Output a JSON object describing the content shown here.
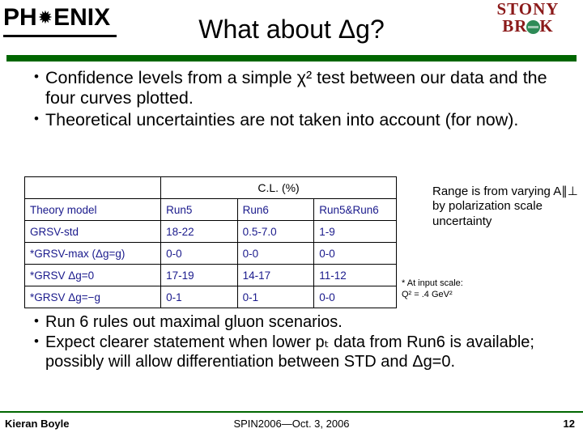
{
  "header": {
    "logo_left": {
      "part1": "PH",
      "star": "✹",
      "part2": "ENIX"
    },
    "title": "What about Δg?",
    "logo_right": {
      "line1": "STONY",
      "line2_a": "BR",
      "line2_b": "K"
    }
  },
  "bullets_top": [
    "Confidence levels from a simple χ² test between our data and the four curves plotted.",
    "Theoretical uncertainties are not taken into account (for now)."
  ],
  "table": {
    "super_header": "C.L. (%)",
    "columns": [
      "Theory model",
      "Run5",
      "Run6",
      "Run5&Run6"
    ],
    "rows": [
      {
        "model": "GRSV-std",
        "run5": "18-22",
        "run6": "0.5-7.0",
        "both": "1-9"
      },
      {
        "model": "*GRSV-max (Δg=g)",
        "run5": "0-0",
        "run6": "0-0",
        "both": "0-0"
      },
      {
        "model": "*GRSV Δg=0",
        "run5": "17-19",
        "run6": "14-17",
        "both": "11-12"
      },
      {
        "model": "*GRSV Δg=−g",
        "run5": "0-1",
        "run6": "0-1",
        "both": "0-0"
      }
    ]
  },
  "range_note": "Range is from varying A∥⊥ by polarization scale uncertainty",
  "footnote_line1": "* At input scale:",
  "footnote_line2": "Q² = .4 GeV²",
  "bullets_bottom": [
    "Run 6 rules out maximal gluon scenarios.",
    "Expect clearer statement when lower pₜ data from Run6 is available; possibly will allow differentiation between STD and Δg=0."
  ],
  "footer": {
    "author": "Kieran Boyle",
    "center": "SPIN2006—Oct. 3, 2006",
    "page": "12"
  }
}
